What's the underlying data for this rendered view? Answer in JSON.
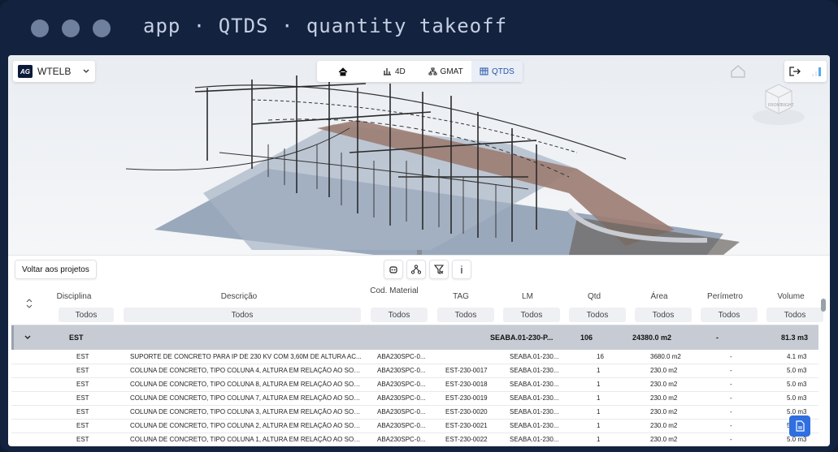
{
  "app_title": "app · QTDS · quantity takeoff",
  "project": {
    "logo": "AG",
    "name": "WTELB"
  },
  "nav": {
    "home_icon": "home-icon",
    "tabs": [
      "4D",
      "GMAT",
      "QTDS"
    ],
    "active": "QTDS"
  },
  "toolbar": {
    "back_label": "Voltar aos projetos",
    "info_label": "i"
  },
  "viewcube": {
    "faces": [
      "FRONT",
      "RIGHT"
    ]
  },
  "table": {
    "columns": [
      "Disciplina",
      "Descrição",
      "Cod. Material",
      "TAG",
      "LM",
      "Qtd",
      "Área",
      "Perímetro",
      "Volume"
    ],
    "filter_value": "Todos",
    "group": {
      "disciplina": "EST",
      "lm": "SEABA.01-230-P...",
      "qtd": "106",
      "area": "24380.0 m2",
      "perimetro": "-",
      "volume": "81.3 m3"
    },
    "rows": [
      [
        "EST",
        "SUPORTE DE CONCRETO PARA IP DE 230 KV COM 3,60M DE ALTURA AC...",
        "ABA230SPC-0...",
        "",
        "SEABA.01-230...",
        "16",
        "3680.0 m2",
        "-",
        "4.1 m3"
      ],
      [
        "EST",
        "COLUNA DE CONCRETO, TIPO COLUNA 4, ALTURA EM RELAÇÃO AO SOL...",
        "ABA230SPC-0...",
        "EST-230-0017",
        "SEABA.01-230...",
        "1",
        "230.0 m2",
        "-",
        "5.0 m3"
      ],
      [
        "EST",
        "COLUNA DE CONCRETO, TIPO COLUNA 8, ALTURA EM RELAÇÃO AO SOL...",
        "ABA230SPC-0...",
        "EST-230-0018",
        "SEABA.01-230...",
        "1",
        "230.0 m2",
        "-",
        "5.0 m3"
      ],
      [
        "EST",
        "COLUNA DE CONCRETO, TIPO COLUNA 7, ALTURA EM RELAÇÃO AO SOL...",
        "ABA230SPC-0...",
        "EST-230-0019",
        "SEABA.01-230...",
        "1",
        "230.0 m2",
        "-",
        "5.0 m3"
      ],
      [
        "EST",
        "COLUNA DE CONCRETO, TIPO COLUNA 3, ALTURA EM RELAÇÃO AO SOL...",
        "ABA230SPC-0...",
        "EST-230-0020",
        "SEABA.01-230...",
        "1",
        "230.0 m2",
        "-",
        "5.0 m3"
      ],
      [
        "EST",
        "COLUNA DE CONCRETO, TIPO COLUNA 2, ALTURA EM RELAÇÃO AO SOL...",
        "ABA230SPC-0...",
        "EST-230-0021",
        "SEABA.01-230...",
        "1",
        "230.0 m2",
        "-",
        "5.0 m3"
      ],
      [
        "EST",
        "COLUNA DE CONCRETO, TIPO COLUNA 1, ALTURA EM RELAÇÃO AO SOL...",
        "ABA230SPC-0...",
        "EST-230-0022",
        "SEABA.01-230...",
        "1",
        "230.0 m2",
        "-",
        "5.0 m3"
      ]
    ]
  },
  "colors": {
    "frame": "#13223e",
    "accent": "#2f6fe0",
    "group_row": "#c7ccd4"
  }
}
